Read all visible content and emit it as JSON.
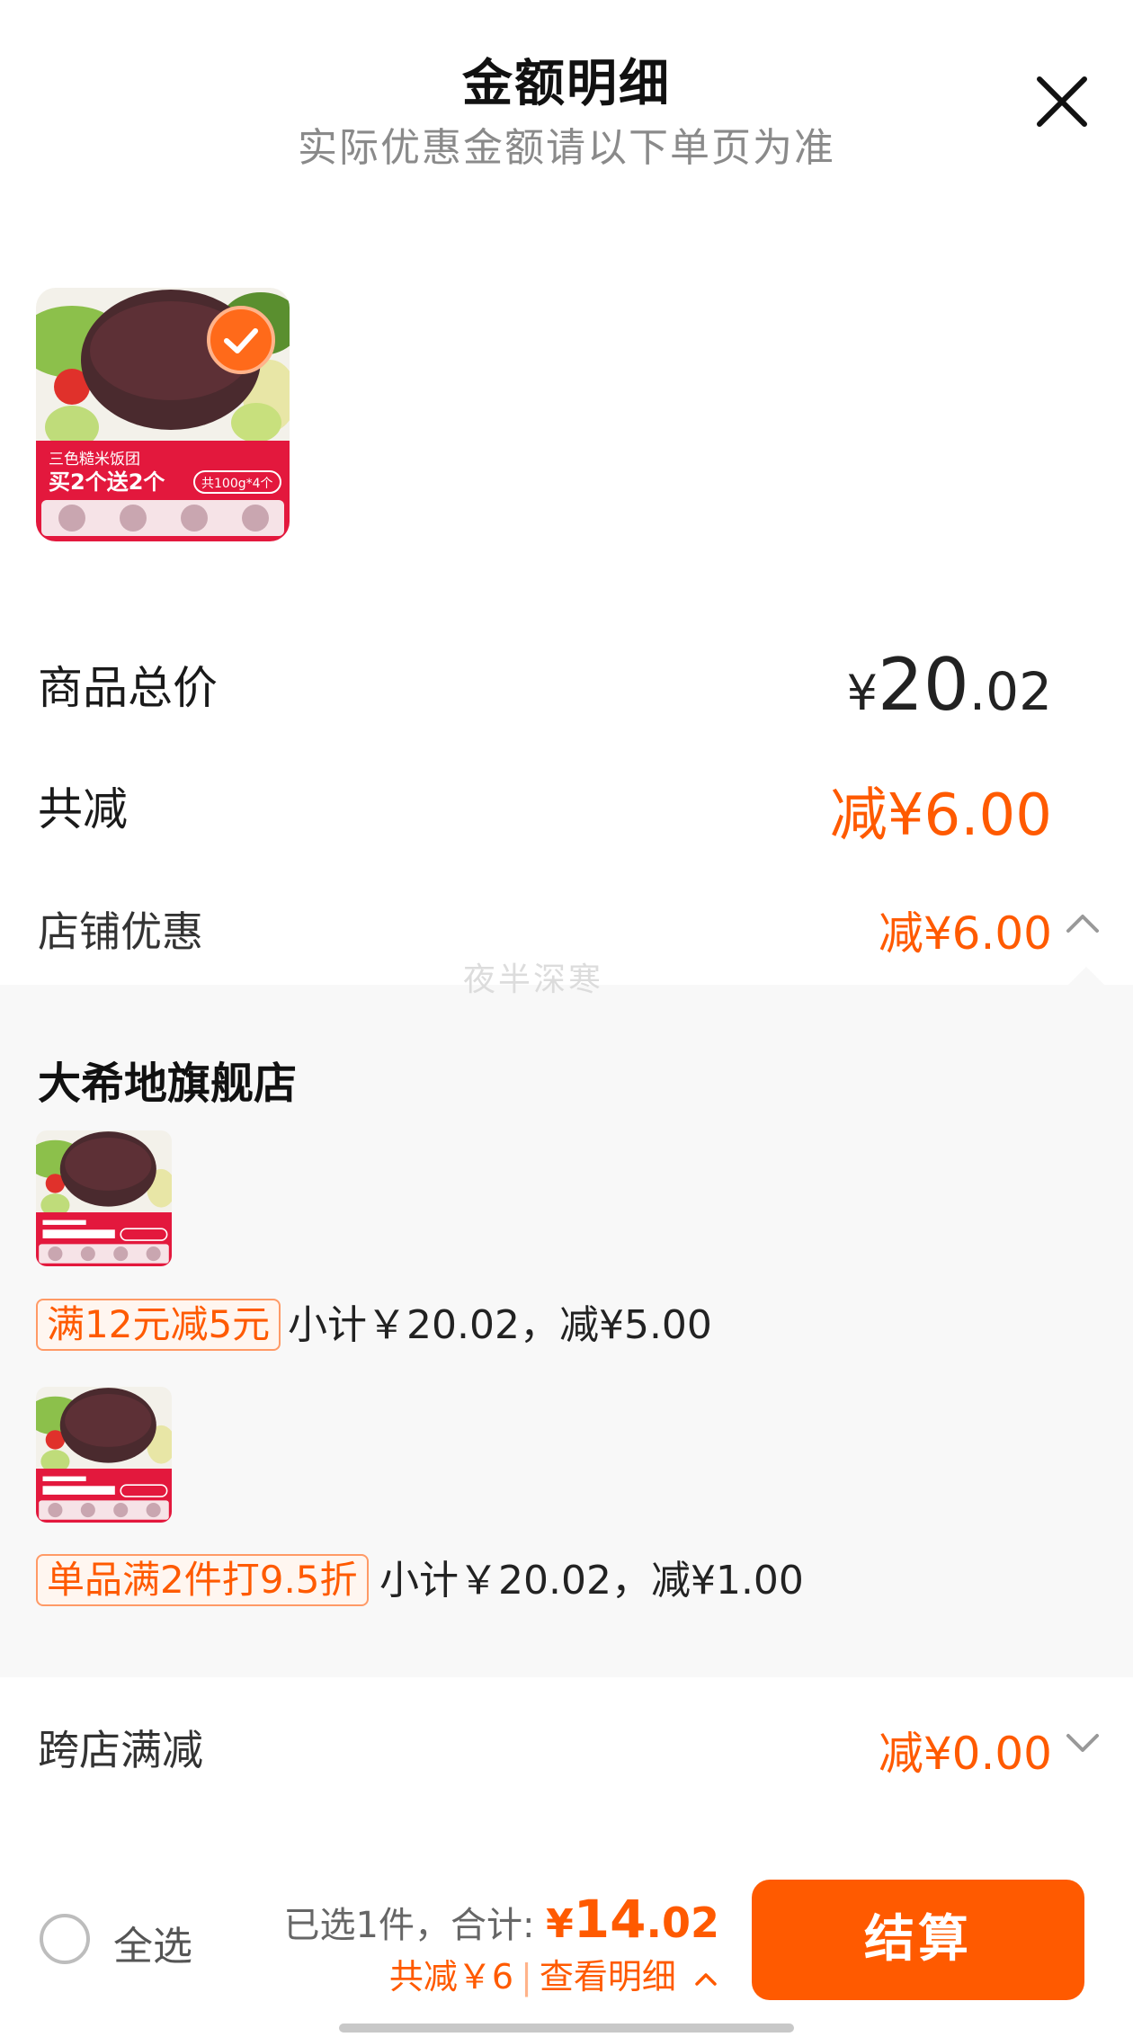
{
  "header": {
    "title": "金额明细",
    "subtitle": "实际优惠金额请以下单页为准",
    "close_icon": "close-icon"
  },
  "product": {
    "image_text": {
      "product_name": "三色糙米饭团",
      "offer": "买2个送2个",
      "pack": "共100g*4个"
    },
    "selected": true
  },
  "summary_rows": {
    "total_label": "商品总价",
    "total_price": {
      "currency": "¥",
      "integer": "20",
      "decimal": ".02"
    },
    "discount_label": "共减",
    "discount_total": "减¥6.00",
    "shop_discount_label": "店铺优惠",
    "shop_discount_value": "减¥6.00",
    "cross_store_label": "跨店满减",
    "cross_store_value": "减¥0.00"
  },
  "watermark": "夜半深寒",
  "shop_detail": {
    "shop_name": "大希地旗舰店",
    "promotions": [
      {
        "tag": "满12元减5元",
        "text": "小计￥20.02，减¥5.00"
      },
      {
        "tag": "单品满2件打9.5折",
        "text": "小计￥20.02，减¥1.00"
      }
    ]
  },
  "bottom_bar": {
    "select_all_label": "全选",
    "selected_prefix": "已选1件，合计: ",
    "total": {
      "currency": "¥",
      "integer": "14",
      "decimal": ".02"
    },
    "saved_text": "共减￥6",
    "details_link": "查看明细",
    "checkout_label": "结算"
  },
  "colors": {
    "accent": "#ff5a00",
    "tag_border": "#ff9a66",
    "panel_bg": "#f8f8f8",
    "text_primary": "#222222",
    "text_secondary": "#8a8a8a"
  }
}
